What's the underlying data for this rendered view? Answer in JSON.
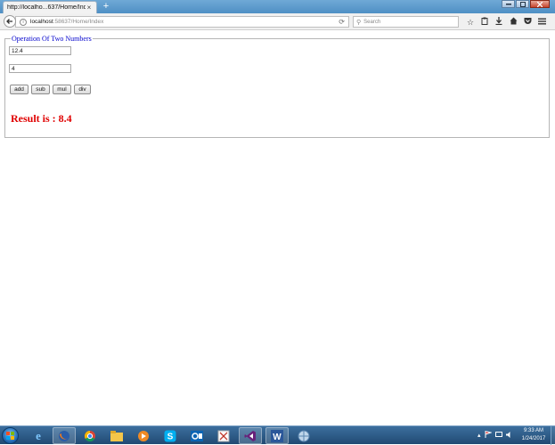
{
  "browser": {
    "tab_title": "http://localho...637/Home/Index",
    "tab_close": "×",
    "new_tab": "+",
    "url_host": "localhost",
    "url_path": ":58637/Home/Index",
    "search_placeholder": "Search",
    "toolbar_icons": [
      "star-icon",
      "clipboard-icon",
      "download-icon",
      "home-icon",
      "pocket-icon",
      "menu-icon"
    ],
    "window_controls": [
      "minimize",
      "maximize",
      "close"
    ]
  },
  "page": {
    "legend": "Operation Of Two Numbers",
    "input1_value": "12.4",
    "input2_value": "4",
    "buttons": {
      "add": "add",
      "sub": "sub",
      "mul": "mul",
      "div": "div"
    },
    "result": "Result is : 8.4",
    "legend_color": "#0000cc",
    "result_color": "#e00000"
  },
  "taskbar": {
    "apps": [
      "internet-explorer",
      "firefox",
      "chrome",
      "file-explorer",
      "media-player",
      "skype",
      "outlook",
      "snipping-tool",
      "visual-studio",
      "word",
      "network-tool"
    ],
    "time": "9:33 AM",
    "date": "1/24/2017"
  }
}
